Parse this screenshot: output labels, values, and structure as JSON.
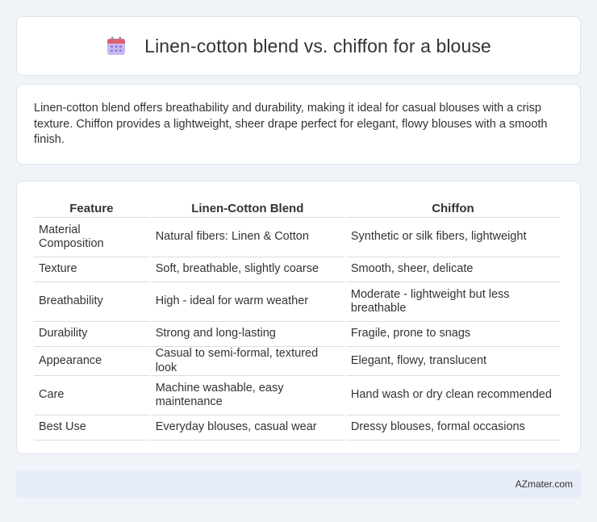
{
  "header": {
    "title": "Linen-cotton blend vs. chiffon for a blouse",
    "icon": "calendar-icon",
    "icon_colors": {
      "top": "#e35d6a",
      "body": "#c9b8f0",
      "dots": "#8d7ae0"
    }
  },
  "summary": {
    "text": "Linen-cotton blend offers breathability and durability, making it ideal for casual blouses with a crisp texture. Chiffon provides a lightweight, sheer drape perfect for elegant, flowy blouses with a smooth finish."
  },
  "table": {
    "headers": [
      "Feature",
      "Linen-Cotton Blend",
      "Chiffon"
    ],
    "rows": [
      [
        "Material Composition",
        "Natural fibers: Linen & Cotton",
        "Synthetic or silk fibers, lightweight"
      ],
      [
        "Texture",
        "Soft, breathable, slightly coarse",
        "Smooth, sheer, delicate"
      ],
      [
        "Breathability",
        "High - ideal for warm weather",
        "Moderate - lightweight but less breathable"
      ],
      [
        "Durability",
        "Strong and long-lasting",
        "Fragile, prone to snags"
      ],
      [
        "Appearance",
        "Casual to semi-formal, textured look",
        "Elegant, flowy, translucent"
      ],
      [
        "Care",
        "Machine washable, easy maintenance",
        "Hand wash or dry clean recommended"
      ],
      [
        "Best Use",
        "Everyday blouses, casual wear",
        "Dressy blouses, formal occasions"
      ]
    ]
  },
  "footer": {
    "text": "AZmater.com"
  },
  "colors": {
    "background": "#f0f3f8",
    "card": "#ffffff",
    "footer_bg": "#e6edf7",
    "text": "#333333"
  }
}
